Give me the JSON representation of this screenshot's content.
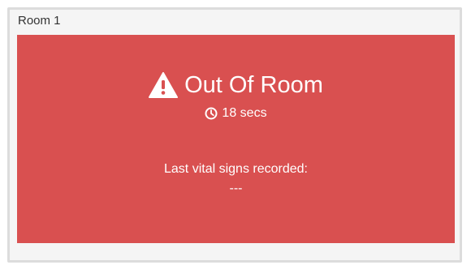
{
  "room": {
    "title": "Room 1"
  },
  "alert": {
    "status_text": "Out Of Room",
    "status_icon": "warning-triangle-icon",
    "timer_icon": "clock-icon",
    "timer_text": "18 secs",
    "vitals_label": "Last vital signs recorded:",
    "vitals_value": "---",
    "background_color": "#d95050",
    "text_color": "#ffffff"
  }
}
